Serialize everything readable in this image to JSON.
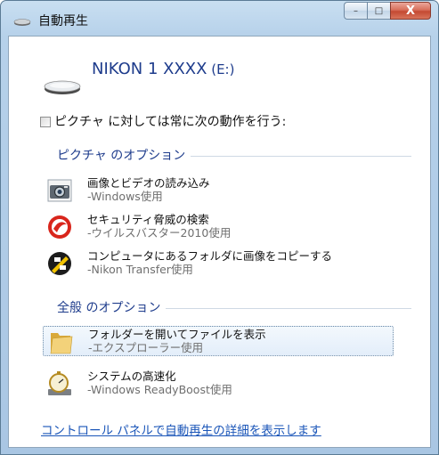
{
  "window": {
    "title": "自動再生",
    "buttons": {
      "minimize": "–",
      "maximize": "□",
      "close": "X"
    }
  },
  "drive": {
    "name": "NIKON 1 XXXX",
    "letter": " (E:)",
    "icon": "removable-drive-icon"
  },
  "always": {
    "checked": false,
    "label": "ピクチャ に対しては常に次の動作を行う:"
  },
  "groups": {
    "picture_options": "ピクチャ のオプション",
    "general_options": "全般 のオプション"
  },
  "picture_items": [
    {
      "title": "画像とビデオの読み込み",
      "subtitle": "-Windows使用",
      "icon": "camera-import-icon"
    },
    {
      "title": "セキュリティ脅威の検索",
      "subtitle": "-ウイルスバスター2010使用",
      "icon": "virus-buster-icon"
    },
    {
      "title": "コンピュータにあるフォルダに画像をコピーする",
      "subtitle": "-Nikon Transfer使用",
      "icon": "nikon-transfer-icon"
    }
  ],
  "general_items": [
    {
      "title": "フォルダーを開いてファイルを表示",
      "subtitle": "-エクスプローラー使用",
      "icon": "folder-icon",
      "selected": true
    },
    {
      "title": "システムの高速化",
      "subtitle": "-Windows ReadyBoost使用",
      "icon": "readyboost-stopwatch-icon"
    }
  ],
  "footer": {
    "link": "コントロール パネルで自動再生の詳細を表示します"
  },
  "colors": {
    "heading_blue": "#1e3c8c",
    "link_blue": "#1a55b8",
    "close_red": "#c44a32"
  }
}
